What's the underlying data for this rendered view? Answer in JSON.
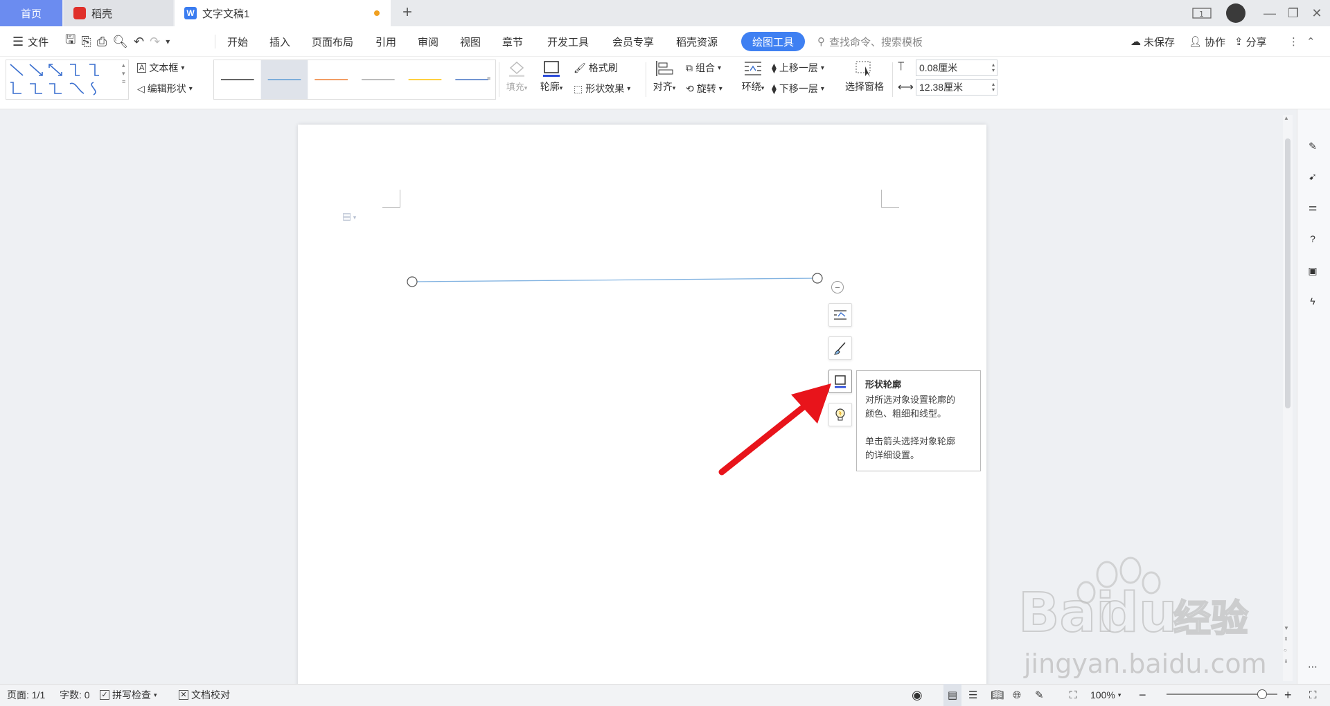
{
  "tabs": {
    "home": "首页",
    "daoke": "稻壳",
    "doc": "文字文稿1"
  },
  "menu": {
    "file": "文件",
    "items": [
      "开始",
      "插入",
      "页面布局",
      "引用",
      "审阅",
      "视图",
      "章节",
      "开发工具",
      "会员专享",
      "稻壳资源"
    ],
    "active": "绘图工具",
    "search_placeholder": "查找命令、搜索模板",
    "unsaved": "未保存",
    "collab": "协作",
    "share": "分享"
  },
  "ribbon": {
    "textbox": "文本框",
    "edit_shape": "编辑形状",
    "fill": "填充",
    "outline": "轮廓",
    "format_painter": "格式刷",
    "shape_effect": "形状效果",
    "align": "对齐",
    "group": "组合",
    "rotate": "旋转",
    "wrap": "环绕",
    "bring_forward": "上移一层",
    "send_backward": "下移一层",
    "select_pane": "选择窗格",
    "height": "0.08厘米",
    "width": "12.38厘米",
    "line_styles": [
      {
        "color": "#333333"
      },
      {
        "color": "#5b9bd5"
      },
      {
        "color": "#ed7d31"
      },
      {
        "color": "#a5a5a5"
      },
      {
        "color": "#ffc000"
      },
      {
        "color": "#4472c4"
      }
    ]
  },
  "tooltip": {
    "title": "形状轮廓",
    "line1": "对所选对象设置轮廓的",
    "line2": "颜色、粗细和线型。",
    "line3": "单击箭头选择对象轮廓",
    "line4": "的详细设置。"
  },
  "status": {
    "page": "页面: 1/1",
    "words": "字数: 0",
    "spell": "拼写检查",
    "proof": "文档校对",
    "zoom": "100%",
    "zoom_level": 0.86
  },
  "colors": {
    "accent": "#3f80f2",
    "home_tab": "#6b8cf0",
    "annotation_arrow": "#e8141b",
    "line_shape": "#7fb1e0"
  },
  "watermark": {
    "brand": "Bai",
    "brand2": "du",
    "cn": "经验",
    "url": "jingyan.baidu.com"
  }
}
